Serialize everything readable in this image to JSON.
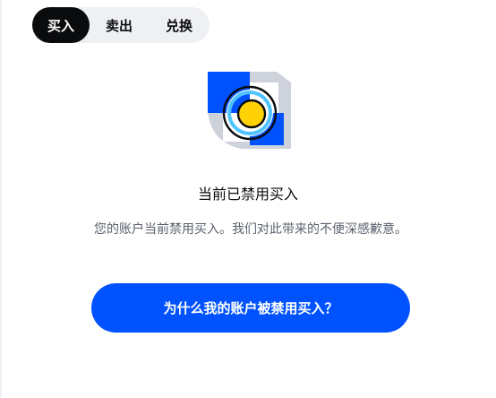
{
  "tabs": {
    "buy_label": "买入",
    "sell_label": "卖出",
    "convert_label": "兑换",
    "active": "buy"
  },
  "notice": {
    "title": "当前已禁用买入",
    "description": "您的账户当前禁用买入。我们对此带来的不便深感歉意。",
    "button_label": "为什么我的账户被禁用买入？"
  },
  "illustration": {
    "icon": "disabled-account-illustration"
  },
  "colors": {
    "brand_blue": "#0052ff",
    "active_tab_bg": "#0a0b0d",
    "tab_bar_bg": "#eef0f3",
    "illustration_gray": "#ced2db",
    "illustration_yellow": "#ffd208",
    "illustration_cyan": "#4fc3ff"
  }
}
